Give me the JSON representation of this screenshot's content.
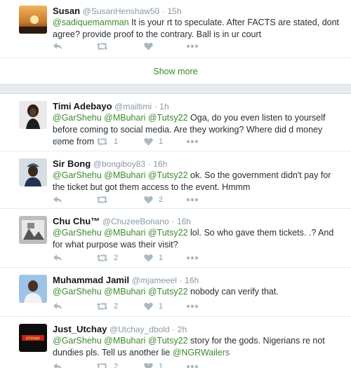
{
  "show_more": "Show more",
  "tweets": [
    {
      "fullname": "Susan",
      "username": "@SusanHenshaw50",
      "time": "15h",
      "segments": [
        {
          "t": "@sadiquemamman",
          "m": true
        },
        {
          "t": " It is your rt to speculate. After FACTS are stated, dont agree? provide proof to the contrary. Ball is in ur court",
          "m": false
        }
      ],
      "reply": "",
      "retweet": "",
      "like": "",
      "avatar": "sunset"
    },
    {
      "fullname": "Timi Adebayo",
      "username": "@mailtimi",
      "time": "1h",
      "segments": [
        {
          "t": "@GarShehu @MBuhari @Tutsy22",
          "m": true
        },
        {
          "t": " Oga, do you even listen to yourself before coming to social media. Are they working? Where did d money come from",
          "m": false
        }
      ],
      "reply": "",
      "retweet": "1",
      "like": "1",
      "avatar": "woman"
    },
    {
      "fullname": "Sir Bong",
      "username": "@bongiboy83",
      "time": "16h",
      "segments": [
        {
          "t": "@GarShehu @MBuhari @Tutsy22",
          "m": true
        },
        {
          "t": " ok. So the government didn't pay for the ticket but got them access to the event. Hmmm",
          "m": false
        }
      ],
      "reply": "",
      "retweet": "",
      "like": "2",
      "avatar": "man-cap"
    },
    {
      "fullname": "Chu Chu™",
      "username": "@ChuzeeBonano",
      "time": "16h",
      "segments": [
        {
          "t": "@GarShehu @MBuhari @Tutsy22",
          "m": true
        },
        {
          "t": " lol. So who gave them tickets. .? And for what purpose was their visit?",
          "m": false
        }
      ],
      "reply": "",
      "retweet": "2",
      "like": "1",
      "avatar": "bw"
    },
    {
      "fullname": "Muhammad Jamil",
      "username": "@mjameeel",
      "time": "16h",
      "segments": [
        {
          "t": "@GarShehu @MBuhari @Tutsy22",
          "m": true
        },
        {
          "t": " nobody can verify that.",
          "m": false
        }
      ],
      "reply": "",
      "retweet": "2",
      "like": "1",
      "avatar": "man-blue"
    },
    {
      "fullname": "Just_Utchay",
      "username": "@Utchay_dbold",
      "time": "2h",
      "segments": [
        {
          "t": "@GarShehu @MBuhari @Tutsy22",
          "m": true
        },
        {
          "t": " story for the gods. Nigerians re not dundies pls. Tell us another lie ",
          "m": false
        },
        {
          "t": "@NGRWailers",
          "m": true
        }
      ],
      "reply": "",
      "retweet": "2",
      "like": "1",
      "avatar": "logo"
    }
  ],
  "colors": {
    "mention": "#3b8a2e",
    "action_icon": "#aab8c2",
    "divider": "#e6ecf0"
  }
}
